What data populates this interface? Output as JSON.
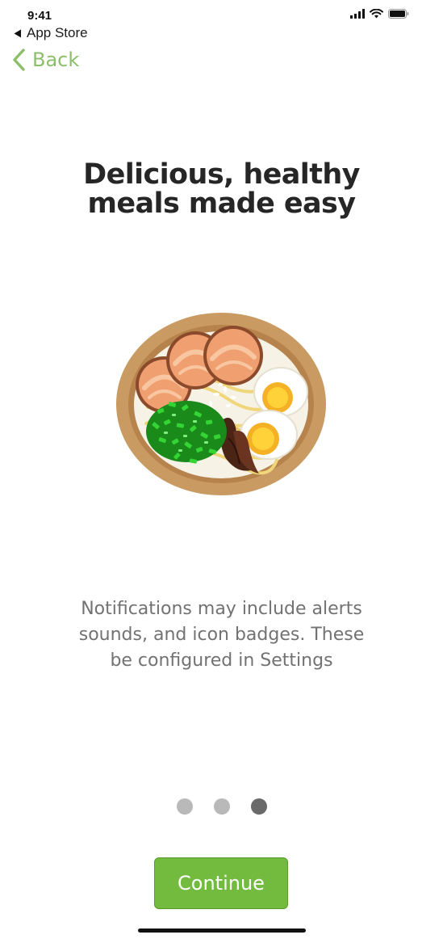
{
  "status_bar": {
    "time": "9:41",
    "icons": [
      "signal-icon",
      "wifi-icon",
      "battery-icon"
    ]
  },
  "breadcrumb": {
    "label": "App Store",
    "icon": "back-triangle-icon"
  },
  "nav": {
    "back_label": "Back",
    "back_icon": "chevron-left-icon",
    "accent_color": "#8bbf6a"
  },
  "title": {
    "lines": [
      "Delicious, healthy",
      "meals made easy"
    ]
  },
  "illustration": {
    "icon": "ramen-bowl-icon"
  },
  "description": {
    "lines": [
      "Notifications may include alerts",
      "sounds, and icon badges. These",
      "be configured in Settings"
    ]
  },
  "pager": {
    "count": 3,
    "active_index": 2
  },
  "cta": {
    "label": "Continue",
    "color": "#72bb3e"
  }
}
